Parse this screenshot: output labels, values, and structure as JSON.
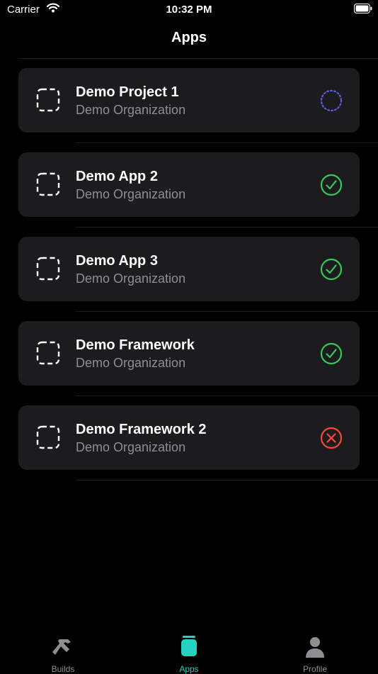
{
  "status_bar": {
    "carrier": "Carrier",
    "time": "10:32 PM"
  },
  "nav": {
    "title": "Apps"
  },
  "apps": [
    {
      "name": "Demo Project 1",
      "org": "Demo Organization",
      "status": "in-progress",
      "status_icon": "dotted-circle-icon"
    },
    {
      "name": "Demo App 2",
      "org": "Demo Organization",
      "status": "success",
      "status_icon": "check-circle-icon"
    },
    {
      "name": "Demo App 3",
      "org": "Demo Organization",
      "status": "success",
      "status_icon": "check-circle-icon"
    },
    {
      "name": "Demo Framework",
      "org": "Demo Organization",
      "status": "success",
      "status_icon": "check-circle-icon"
    },
    {
      "name": "Demo Framework 2",
      "org": "Demo Organization",
      "status": "failed",
      "status_icon": "x-circle-icon"
    }
  ],
  "tabs": [
    {
      "label": "Builds",
      "icon": "hammer-icon",
      "active": false
    },
    {
      "label": "Apps",
      "icon": "apps-icon",
      "active": true
    },
    {
      "label": "Profile",
      "icon": "person-icon",
      "active": false
    }
  ],
  "colors": {
    "background": "#000000",
    "card": "#1c1c1e",
    "secondary_text": "#8e8e93",
    "success": "#34c759",
    "failed": "#ff453a",
    "in_progress": "#5e5ce6",
    "accent": "#27d1c1"
  }
}
